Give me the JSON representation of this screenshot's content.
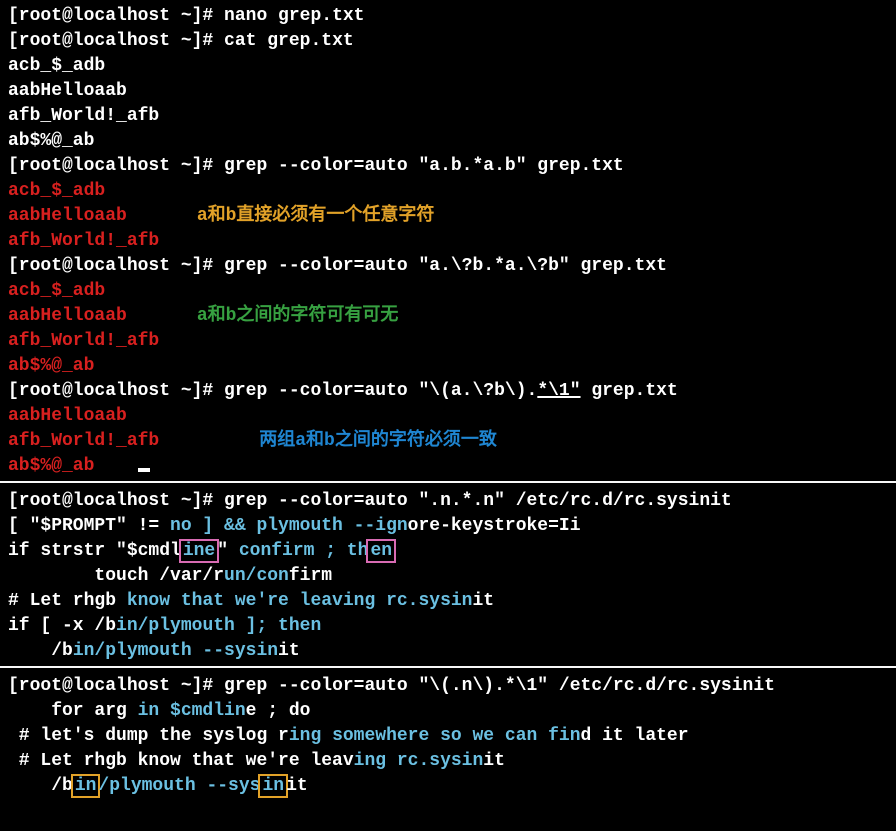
{
  "block1": {
    "prompt": "[root@localhost ~]# ",
    "cmd_nano": "nano grep.txt",
    "cmd_cat": "cat grep.txt",
    "cat_out": [
      "acb_$_adb",
      "aabHelloaab",
      "afb_World!_afb",
      "ab$%@_ab"
    ]
  },
  "grep1": {
    "prompt": "[root@localhost ~]# ",
    "cmd": "grep --color=auto \"a.b.*a.b\" grep.txt",
    "out": [
      "acb_$_adb",
      "aabHelloaab",
      "afb_World!_afb"
    ],
    "annotation": "a和b直接必须有一个任意字符"
  },
  "grep2": {
    "prompt": "[root@localhost ~]# ",
    "cmd": "grep --color=auto \"a.\\?b.*a.\\?b\" grep.txt",
    "out": [
      "acb_$_adb",
      "aabHelloaab",
      "afb_World!_afb",
      "ab$%@_ab"
    ],
    "annotation": "a和b之间的字符可有可无"
  },
  "grep3": {
    "prompt": "[root@localhost ~]# ",
    "cmd_pre": "grep --color=auto \"\\(a.\\?b\\).",
    "cmd_ul": "*\\1\"",
    "cmd_post": " grep.txt",
    "out": [
      "aabHelloaab",
      "afb_World!_afb",
      "ab$%@_ab"
    ],
    "annotation": "两组a和b之间的字符必须一致"
  },
  "grep4": {
    "prompt": "[root@localhost ~]# ",
    "cmd": "grep --color=auto \".n.*.n\" /etc/rc.d/rc.sysinit",
    "l1_pre": "[ \"$PROMPT\" != ",
    "l1_hi": "no ] && plymouth --ign",
    "l1_post": "ore-keystroke=Ii",
    "l2_pre": "if strstr \"$cmdl",
    "l2_box1": "ine",
    "l2_mid": "\" ",
    "l2_hi": "confirm ; th",
    "l2_box2": "en",
    "l3_pre": "        touch /var/r",
    "l3_hi": "un/con",
    "l3_post": "firm",
    "l4_pre": "# Let rhgb ",
    "l4_hi": "know that we're leaving rc.sysin",
    "l4_post": "it",
    "l5_pre": "if [ -x /b",
    "l5_hi": "in/plymouth ]; then",
    "l6_pre": "    /b",
    "l6_hi": "in/plymouth --sysin",
    "l6_post": "it"
  },
  "grep5": {
    "prompt": "[root@localhost ~]# ",
    "cmd": "grep --color=auto \"\\(.n\\).*\\1\" /etc/rc.d/rc.sysinit",
    "l1_pre": "    for arg ",
    "l1_hi": "in $cmdlin",
    "l1_post": "e ; do",
    "l2_pre": " # let's dump the syslog r",
    "l2_hi": "ing somewhere so we can fin",
    "l2_post": "d it later",
    "l3_pre": " # Let rhgb know that we're leav",
    "l3_hi": "ing rc.sysin",
    "l3_post": "it",
    "l4_pre": "    /b",
    "l4_box1": "in",
    "l4_hi": "/plymouth --sys",
    "l4_box2": "in",
    "l4_post": "it"
  }
}
